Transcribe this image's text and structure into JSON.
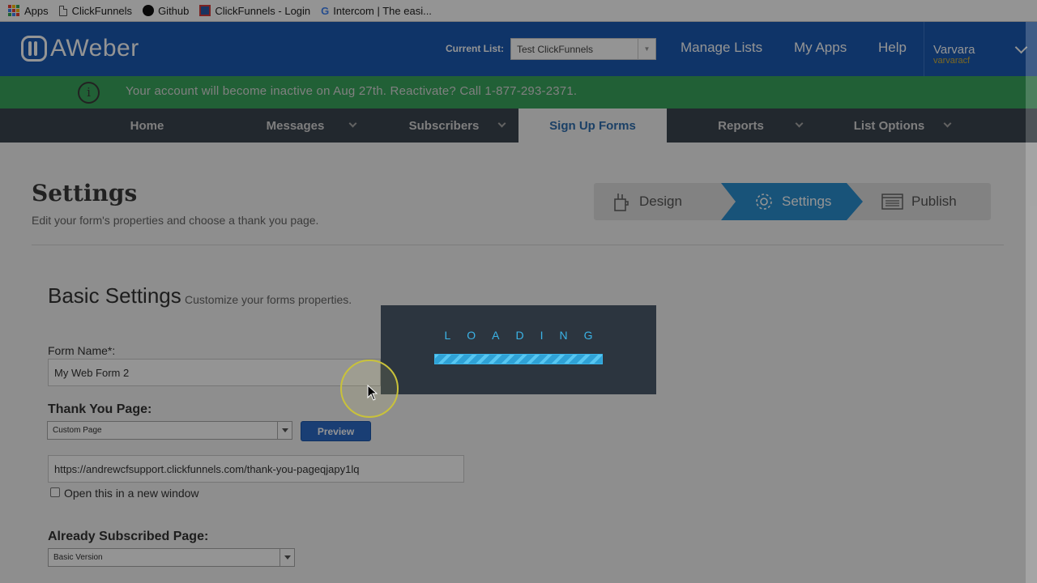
{
  "bookmarks": [
    {
      "label": "Apps",
      "icon": "apps-grid-icon"
    },
    {
      "label": "ClickFunnels",
      "icon": "document-icon"
    },
    {
      "label": "Github",
      "icon": "github-icon"
    },
    {
      "label": "ClickFunnels - Login",
      "icon": "clickfunnels-icon"
    },
    {
      "label": "Intercom | The easi...",
      "icon": "google-icon"
    }
  ],
  "header": {
    "logo_text": "AWeber",
    "current_list_label": "Current List:",
    "current_list_value": "Test ClickFunnels",
    "nav": [
      "Manage Lists",
      "My Apps",
      "Help"
    ],
    "user_name": "Varvara",
    "user_handle": "varvaracf",
    "brand_color": "#1b5bb3"
  },
  "banner": {
    "text": "Your account will become inactive on Aug 27th. Reactivate? Call 1-877-293-2371.",
    "icon": "info-icon",
    "color": "#3aa55d"
  },
  "tabs": [
    {
      "label": "Home",
      "has_menu": false,
      "active": false
    },
    {
      "label": "Messages",
      "has_menu": true,
      "active": false
    },
    {
      "label": "Subscribers",
      "has_menu": true,
      "active": false
    },
    {
      "label": "Sign Up Forms",
      "has_menu": false,
      "active": true
    },
    {
      "label": "Reports",
      "has_menu": true,
      "active": false
    },
    {
      "label": "List Options",
      "has_menu": true,
      "active": false
    }
  ],
  "page": {
    "title": "Settings",
    "subtitle": "Edit your form's properties and choose a thank you page."
  },
  "steps": [
    {
      "label": "Design",
      "icon": "design-tools-icon",
      "active": false
    },
    {
      "label": "Settings",
      "icon": "gear-icon",
      "active": true
    },
    {
      "label": "Publish",
      "icon": "publish-icon",
      "active": false
    }
  ],
  "basic_settings": {
    "title": "Basic Settings",
    "subtitle": "Customize your forms properties.",
    "form_name_label": "Form Name*:",
    "form_name_value": "My Web Form 2",
    "thank_you_label": "Thank You Page:",
    "thank_you_select": "Custom Page",
    "preview_button": "Preview",
    "thank_you_url": "https://andrewcfsupport.clickfunnels.com/thank-you-pageqjapy1lq",
    "new_window_label": "Open this in a new window",
    "new_window_checked": false,
    "already_subscribed_label": "Already Subscribed Page:",
    "already_subscribed_select": "Basic Version"
  },
  "loading": {
    "text": "LOADING",
    "accent": "#3bb3e6"
  }
}
